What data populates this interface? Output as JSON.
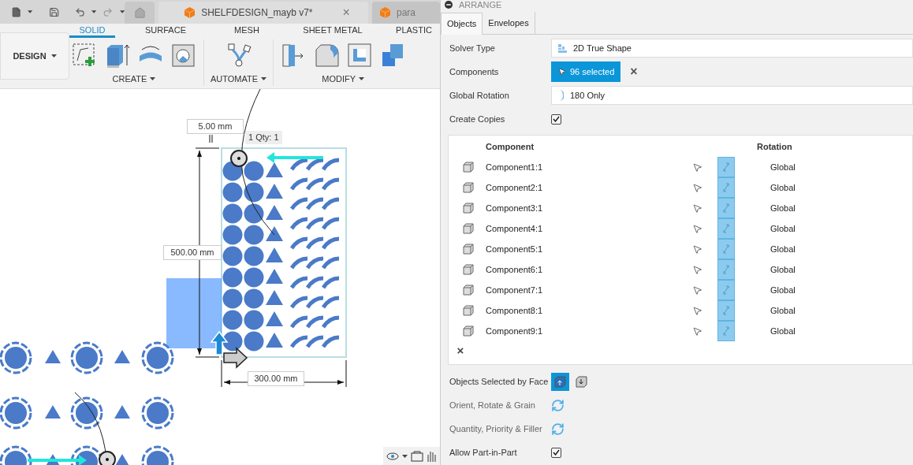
{
  "toolbar": {
    "document_tabs": [
      {
        "title": "SHELFDESIGN_mayb v7*",
        "selected": true,
        "close": "×"
      },
      {
        "title": "para",
        "selected": false
      }
    ]
  },
  "ribbon": {
    "workspace": "DESIGN",
    "tabs": [
      {
        "label": "SOLID",
        "selected": true
      },
      {
        "label": "SURFACE",
        "selected": false
      },
      {
        "label": "MESH",
        "selected": false
      },
      {
        "label": "SHEET METAL",
        "selected": false
      },
      {
        "label": "PLASTIC",
        "selected": false
      }
    ],
    "groups": [
      {
        "label": "CREATE"
      },
      {
        "label": "AUTOMATE"
      },
      {
        "label": "MODIFY"
      }
    ]
  },
  "canvas": {
    "gap_label": "5.00 mm",
    "part_label": "1 Qty: 1",
    "height_label": "500.00 mm",
    "width_label": "300.00 mm"
  },
  "panel": {
    "title": "ARRANGE",
    "tabs": [
      {
        "label": "Objects",
        "selected": true
      },
      {
        "label": "Envelopes",
        "selected": false
      }
    ],
    "fields": [
      {
        "label": "Solver Type",
        "kind": "dropdown",
        "value": "2D True Shape"
      },
      {
        "label": "Components",
        "kind": "selection",
        "value": "96 selected",
        "clear": "×"
      },
      {
        "label": "Global Rotation",
        "kind": "rotation",
        "value": "180 Only"
      },
      {
        "label": "Create Copies",
        "kind": "checkbox",
        "checked": true
      }
    ],
    "table": {
      "columns": [
        "Component",
        "Rotation"
      ],
      "rows": [
        {
          "name": "Component1:1",
          "rotation": "Global"
        },
        {
          "name": "Component2:1",
          "rotation": "Global"
        },
        {
          "name": "Component3:1",
          "rotation": "Global"
        },
        {
          "name": "Component4:1",
          "rotation": "Global"
        },
        {
          "name": "Component5:1",
          "rotation": "Global"
        },
        {
          "name": "Component6:1",
          "rotation": "Global"
        },
        {
          "name": "Component7:1",
          "rotation": "Global"
        },
        {
          "name": "Component8:1",
          "rotation": "Global"
        },
        {
          "name": "Component9:1",
          "rotation": "Global"
        }
      ],
      "remove": "×"
    },
    "options": [
      {
        "label": "Objects Selected by Face",
        "kind": "face_choice",
        "choices": [
          {
            "selected": true
          },
          {
            "selected": false
          }
        ]
      },
      {
        "label": "Orient, Rotate & Grain",
        "kind": "settings"
      },
      {
        "label": "Quantity, Priority & Filler",
        "kind": "settings"
      },
      {
        "label": "Allow Part-in-Part",
        "kind": "checkbox",
        "checked": true
      }
    ]
  }
}
